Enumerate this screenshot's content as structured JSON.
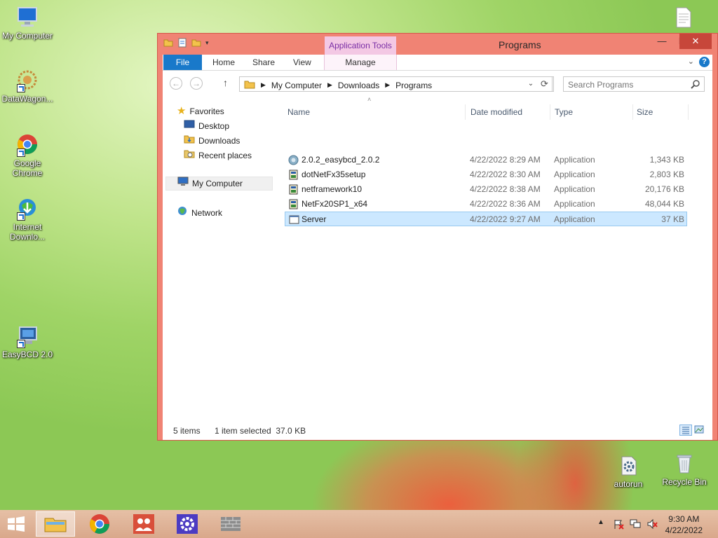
{
  "desktop": {
    "icons_left": [
      {
        "label": "My Computer",
        "icon": "computer-icon"
      },
      {
        "label": "DataWagon...",
        "icon": "datawagon-icon"
      },
      {
        "label": "Google Chrome",
        "icon": "chrome-icon"
      },
      {
        "label": "Internet Downlo...",
        "icon": "internet-download-icon"
      },
      {
        "label": "EasyBCD 2.0",
        "icon": "easybcd-icon"
      }
    ],
    "icons_right": [
      {
        "label": "autorun",
        "icon": "autorun-icon"
      },
      {
        "label": "Recycle Bin",
        "icon": "recycle-bin-icon"
      }
    ]
  },
  "window": {
    "title": "Programs",
    "contextual_tab_group": "Application Tools",
    "ribbon_tabs": [
      "File",
      "Home",
      "Share",
      "View",
      "Manage"
    ],
    "breadcrumb": [
      "My Computer",
      "Downloads",
      "Programs"
    ],
    "search_placeholder": "Search Programs",
    "nav_pane": {
      "favorites": "Favorites",
      "favorites_items": [
        "Desktop",
        "Downloads",
        "Recent places"
      ],
      "computer": "My Computer",
      "network": "Network"
    },
    "columns": [
      "Name",
      "Date modified",
      "Type",
      "Size"
    ],
    "files": [
      {
        "name": "2.0.2_easybcd_2.0.2",
        "date": "4/22/2022 8:29 AM",
        "type": "Application",
        "size": "1,343 KB",
        "selected": false
      },
      {
        "name": "dotNetFx35setup",
        "date": "4/22/2022 8:30 AM",
        "type": "Application",
        "size": "2,803 KB",
        "selected": false
      },
      {
        "name": "netframework10",
        "date": "4/22/2022 8:38 AM",
        "type": "Application",
        "size": "20,176 KB",
        "selected": false
      },
      {
        "name": "NetFx20SP1_x64",
        "date": "4/22/2022 8:36 AM",
        "type": "Application",
        "size": "48,044 KB",
        "selected": false
      },
      {
        "name": "Server",
        "date": "4/22/2022 9:27 AM",
        "type": "Application",
        "size": "37 KB",
        "selected": true
      }
    ],
    "status": {
      "items": "5 items",
      "selection": "1 item selected  37.0 KB"
    }
  },
  "taskbar": {
    "apps": [
      "file-explorer-icon",
      "chrome-icon",
      "people-app-icon",
      "settings-app-icon",
      "firewall-app-icon"
    ],
    "clock_time": "9:30 AM",
    "clock_date": "4/22/2022"
  }
}
